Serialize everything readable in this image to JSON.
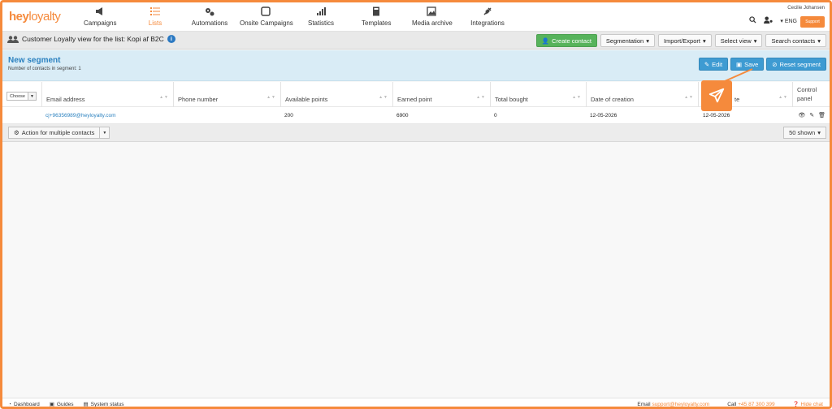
{
  "brand": {
    "logo_hey": "hey",
    "logo_loyalty": "loyalty",
    "accent": "#f58a3c",
    "blue": "#2a80bf",
    "green": "#57b35b"
  },
  "nav": {
    "items": [
      {
        "label": "Campaigns",
        "icon": "megaphone-icon"
      },
      {
        "label": "Lists",
        "icon": "list-icon",
        "active": true
      },
      {
        "label": "Automations",
        "icon": "gears-icon"
      },
      {
        "label": "Onsite Campaigns",
        "icon": "window-icon"
      },
      {
        "label": "Statistics",
        "icon": "bar-chart-icon"
      },
      {
        "label": "Templates",
        "icon": "template-icon"
      },
      {
        "label": "Media archive",
        "icon": "image-icon"
      },
      {
        "label": "Integrations",
        "icon": "plug-icon"
      }
    ],
    "user_name": "Cecilie Johansen",
    "language": "▾ ENG",
    "support_label": "Support"
  },
  "viewbar": {
    "title": "Customer Loyalty view for the list: Kopi af B2C",
    "info": "i",
    "buttons": {
      "create": "Create contact",
      "segmentation": "Segmentation",
      "import_export": "Import/Export",
      "select_view": "Select view",
      "search": "Search contacts"
    }
  },
  "segment": {
    "title": "New segment",
    "count_text": "Number of contacts in segment: 1",
    "edit": "Edit",
    "save": "Save",
    "reset": "Reset segment"
  },
  "table": {
    "choose": "Choose",
    "columns": [
      "Email address",
      "Phone number",
      "Available points",
      "Earned point",
      "Total bought",
      "Date of creation",
      "te",
      "Control panel"
    ],
    "row": {
      "email": "cj+96356989@heyloyalty.com",
      "phone": "",
      "available": "200",
      "earned": "6900",
      "bought": "0",
      "created": "12-05-2026",
      "updated": "12-05-2026"
    }
  },
  "toolbar": {
    "multi": "Action for multiple contacts",
    "shown": "50 shown"
  },
  "statusbar": {
    "dashboard": "Dashboard",
    "guides": "Guides",
    "system_status": "System status",
    "email_label": "Email",
    "email": "support@heyloyalty.com",
    "call_label": "Call",
    "phone": "+45 87 300 399",
    "hide_chat": "Hide chat"
  }
}
